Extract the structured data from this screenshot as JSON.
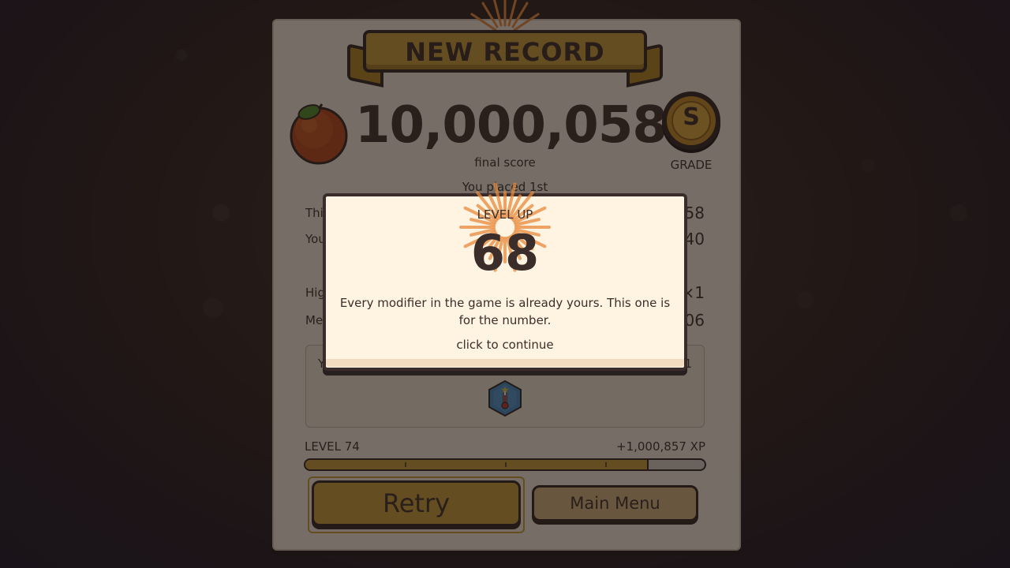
{
  "results": {
    "banner": "NEW RECORD",
    "score": "10,000,058",
    "score_label": "final score",
    "placement": "You placed 1st",
    "grade": {
      "letter": "S",
      "label": "GRADE"
    },
    "rows": [
      {
        "label": "Thi",
        "value": "58"
      },
      {
        "label": "You",
        "value": "40"
      },
      {
        "label": "Hig",
        "value": "×1"
      },
      {
        "label": "Me",
        "value": "06"
      }
    ],
    "unlock": {
      "left_text": "Y",
      "right_text": "1",
      "icon": "thermometer-hex-icon"
    },
    "level": {
      "label": "LEVEL 74",
      "xp_gain": "+1,000,857 XP",
      "progress": 0.86
    },
    "buttons": {
      "retry": "Retry",
      "main_menu": "Main Menu"
    }
  },
  "level_up": {
    "title": "LEVEL UP",
    "level": "68",
    "message": "Every modifier in the game is already yours. This one is for the number.",
    "cta": "click to continue"
  },
  "colors": {
    "accent_gold": "#c59b37",
    "panel_bg": "#f1e8dc",
    "dialog_bg": "#fff3e1",
    "ink": "#3b2e2a",
    "burst_orange": "#e8893a"
  }
}
